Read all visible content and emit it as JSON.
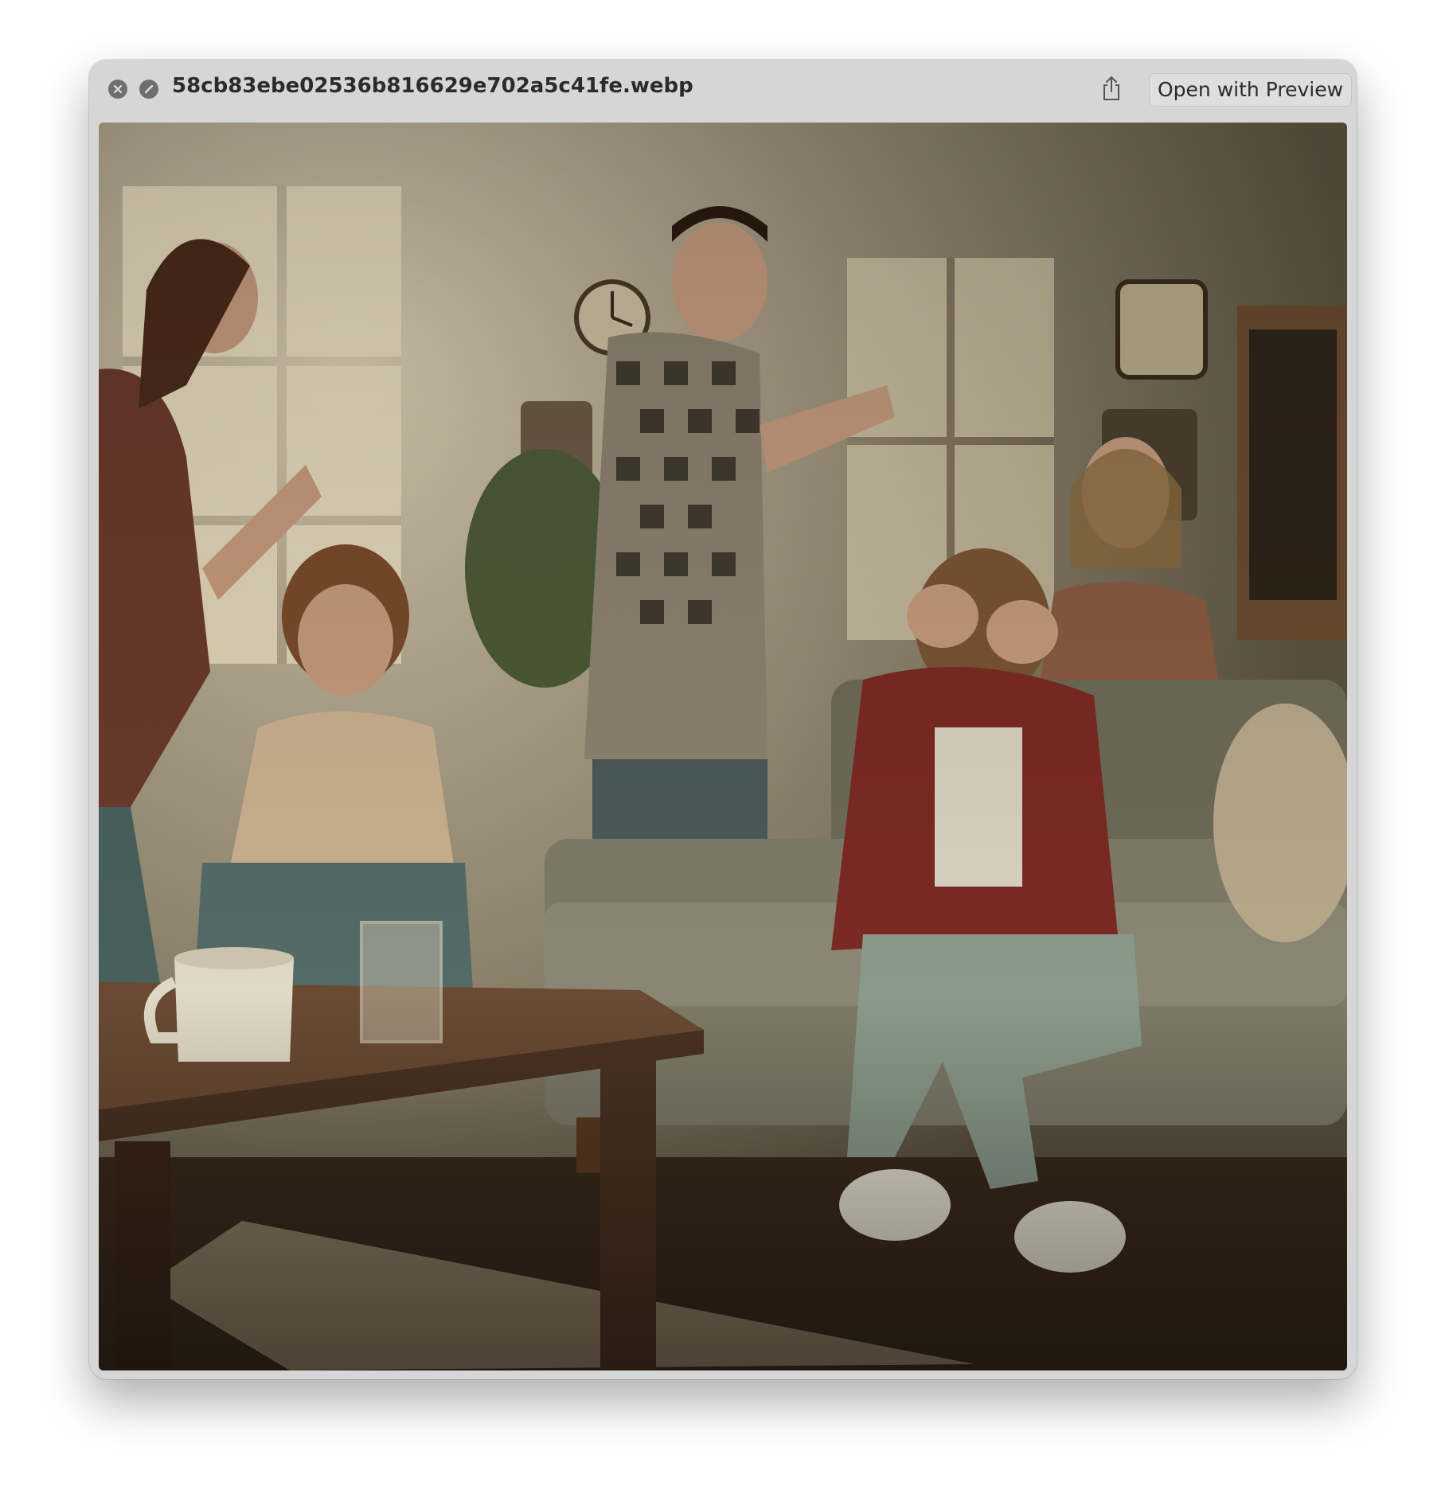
{
  "window": {
    "filename": "58cb83ebe02536b816629e702a5c41fe.webp",
    "close_icon": "close-icon",
    "fullscreen_icon": "fullscreen-icon",
    "share_icon": "share-icon",
    "open_with_label": "Open with Preview"
  },
  "image": {
    "colors": {
      "wall": "#5b5240",
      "floor": "#3a2a1c",
      "sofa": "#7d7a68",
      "table": "#6a4a32"
    }
  }
}
